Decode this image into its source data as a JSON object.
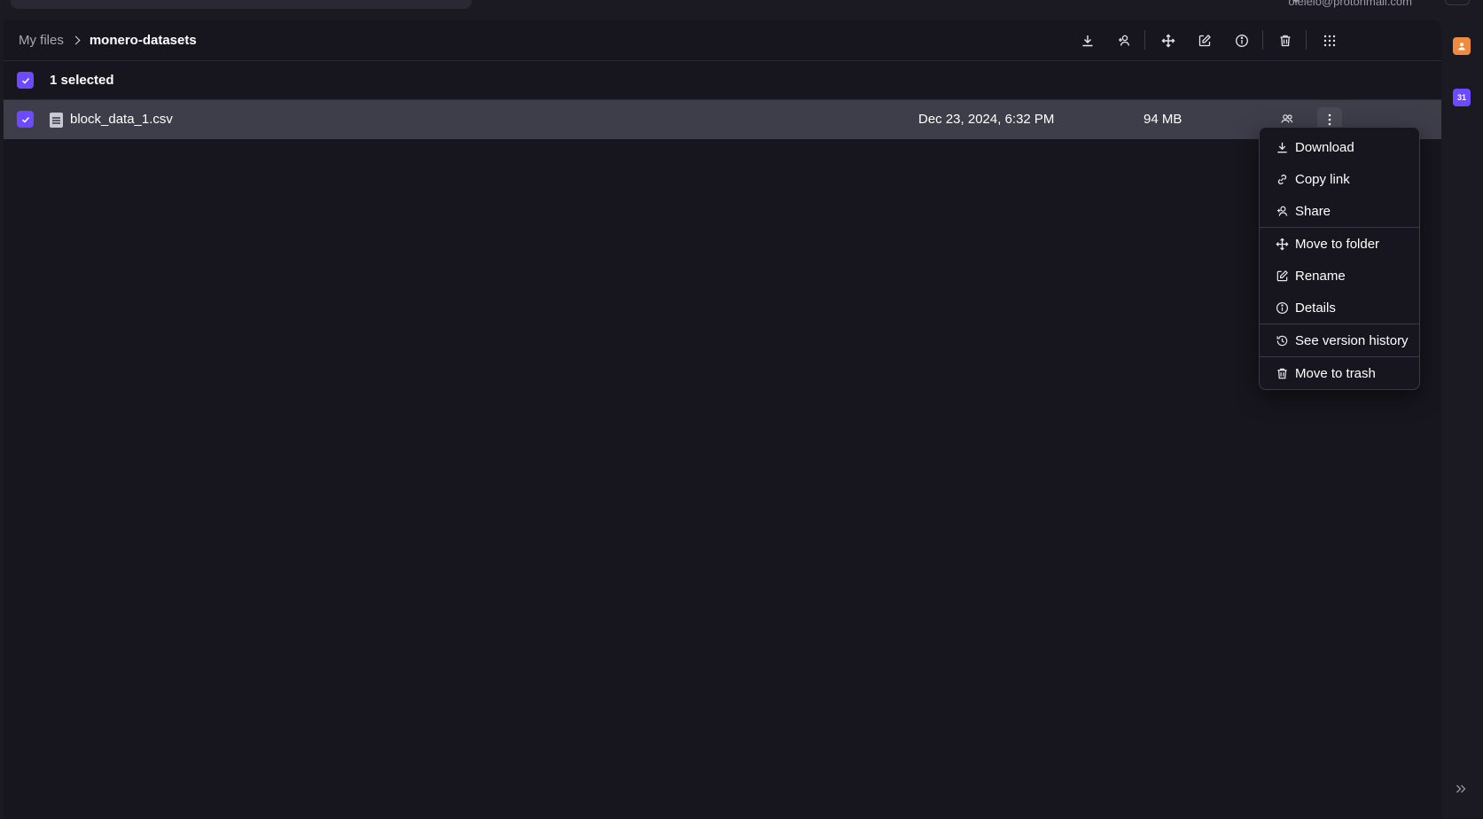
{
  "header": {
    "account_email": "olelelo@protonmail.com"
  },
  "breadcrumb": {
    "root": "My files",
    "current": "monero-datasets"
  },
  "toolbar": {
    "icons": [
      "download-icon",
      "share-icon",
      "move-icon",
      "rename-icon",
      "details-icon",
      "trash-icon",
      "grid-icon"
    ]
  },
  "selection": {
    "label": "1 selected"
  },
  "files": [
    {
      "name": "block_data_1.csv",
      "modified": "Dec 23, 2024, 6:32 PM",
      "size": "94 MB",
      "selected": true,
      "shared_icon": "users-icon"
    }
  ],
  "context_menu": {
    "items": [
      {
        "label": "Download",
        "icon": "download-icon"
      },
      {
        "label": "Copy link",
        "icon": "link-icon"
      },
      {
        "label": "Share",
        "icon": "share-icon"
      },
      {
        "label": "Move to folder",
        "icon": "move-icon"
      },
      {
        "label": "Rename",
        "icon": "rename-icon"
      },
      {
        "label": "Details",
        "icon": "details-icon"
      },
      {
        "label": "See version history",
        "icon": "history-icon"
      },
      {
        "label": "Move to trash",
        "icon": "trash-icon"
      }
    ]
  },
  "right_rail": {
    "apps": [
      {
        "name": "contacts",
        "color": "#f08a3c"
      },
      {
        "name": "calendar",
        "label": "31",
        "color": "#6d4aff"
      }
    ]
  },
  "colors": {
    "accent": "#6d4aff",
    "background": "#17161e",
    "row_selected": "#3e3d4a"
  }
}
